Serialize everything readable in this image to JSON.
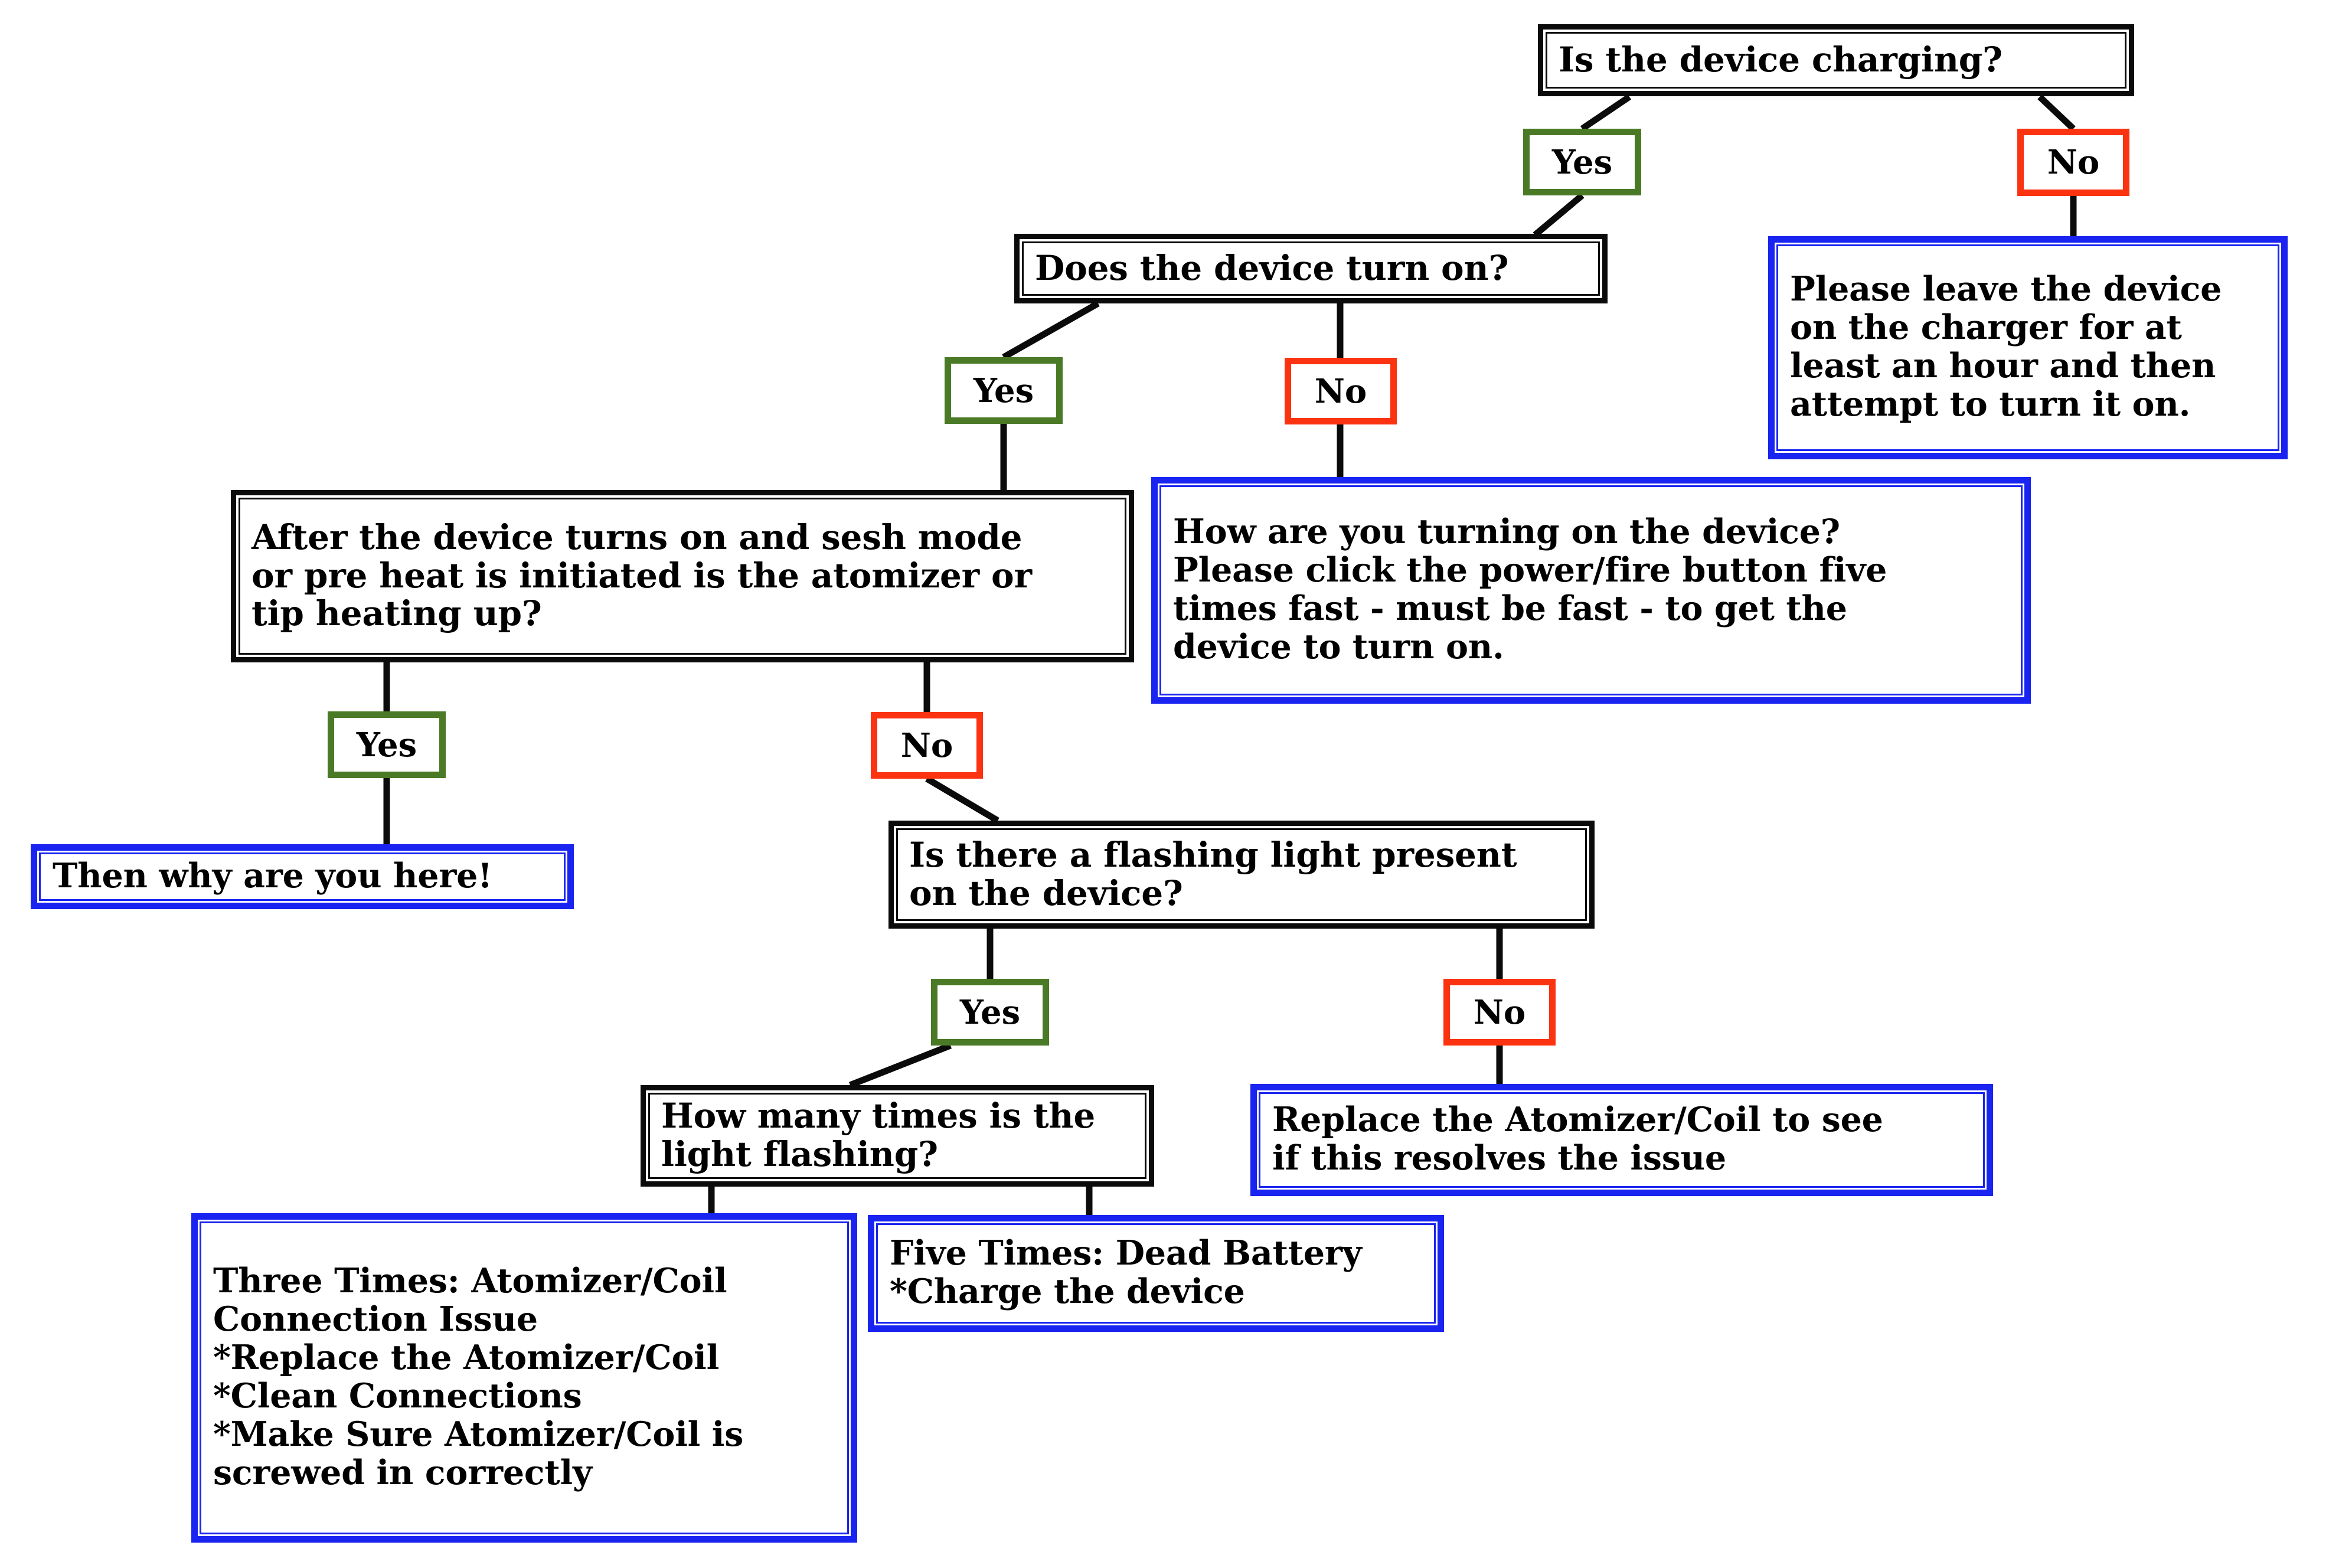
{
  "palette": {
    "black": "#0b0b0b",
    "blue": "#1a24f0",
    "green": "#4a7a26",
    "red": "#fb3311",
    "background": "#ffffff"
  },
  "nodes": {
    "q_charging": {
      "text": "Is the device charging?"
    },
    "q_turn_on": {
      "text": "Does the device turn on?"
    },
    "q_heating": {
      "text": "After the device turns on and sesh mode\nor pre heat is initiated is the atomizer or\ntip heating up?"
    },
    "q_flashing": {
      "text": "Is there a flashing light present\non the device?"
    },
    "q_how_many": {
      "text": "How many times is the\nlight flashing?"
    },
    "r_leave_charger": {
      "text": "Please leave the device\non the charger for at\nleast an hour and then\nattempt to turn it on."
    },
    "r_how_turning": {
      "text": "How are you turning on the device?\nPlease click the power/fire button five\ntimes fast - must be fast - to get the\ndevice to turn on."
    },
    "r_why_here": {
      "text": "Then why are you here!"
    },
    "r_replace_coil": {
      "text": "Replace the Atomizer/Coil to see\nif this resolves the issue"
    },
    "r_three_times": {
      "text": "Three Times: Atomizer/Coil\nConnection Issue\n*Replace the Atomizer/Coil\n*Clean Connections\n*Make Sure Atomizer/Coil is\nscrewed in correctly"
    },
    "r_five_times": {
      "text": "Five Times: Dead Battery\n*Charge the device"
    }
  },
  "chips": {
    "charging_yes": {
      "text": "Yes"
    },
    "charging_no": {
      "text": "No"
    },
    "turnon_yes": {
      "text": "Yes"
    },
    "turnon_no": {
      "text": "No"
    },
    "heating_yes": {
      "text": "Yes"
    },
    "heating_no": {
      "text": "No"
    },
    "flashing_yes": {
      "text": "Yes"
    },
    "flashing_no": {
      "text": "No"
    }
  },
  "chart_data": {
    "type": "diagram",
    "title": "Device Troubleshooting Flowchart",
    "nodes": [
      {
        "id": "q_charging",
        "kind": "question",
        "label": "Is the device charging?"
      },
      {
        "id": "q_turn_on",
        "kind": "question",
        "label": "Does the device turn on?"
      },
      {
        "id": "q_heating",
        "kind": "question",
        "label": "After the device turns on and sesh mode or pre heat is initiated is the atomizer or tip heating up?"
      },
      {
        "id": "q_flashing",
        "kind": "question",
        "label": "Is there a flashing light present on the device?"
      },
      {
        "id": "q_how_many",
        "kind": "question",
        "label": "How many times is the light flashing?"
      },
      {
        "id": "r_leave_charger",
        "kind": "answer",
        "label": "Please leave the device on the charger for at least an hour and then attempt to turn it on."
      },
      {
        "id": "r_how_turning",
        "kind": "answer",
        "label": "How are you turning on the device? Please click the power/fire button five times fast - must be fast - to get the device to turn on."
      },
      {
        "id": "r_why_here",
        "kind": "answer",
        "label": "Then why are you here!"
      },
      {
        "id": "r_replace_coil",
        "kind": "answer",
        "label": "Replace the Atomizer/Coil to see if this resolves the issue"
      },
      {
        "id": "r_three_times",
        "kind": "answer",
        "label": "Three Times: Atomizer/Coil Connection Issue *Replace the Atomizer/Coil *Clean Connections *Make Sure Atomizer/Coil is screwed in correctly"
      },
      {
        "id": "r_five_times",
        "kind": "answer",
        "label": "Five Times: Dead Battery *Charge the device"
      }
    ],
    "edges": [
      {
        "from": "q_charging",
        "to": "q_turn_on",
        "label": "Yes"
      },
      {
        "from": "q_charging",
        "to": "r_leave_charger",
        "label": "No"
      },
      {
        "from": "q_turn_on",
        "to": "q_heating",
        "label": "Yes"
      },
      {
        "from": "q_turn_on",
        "to": "r_how_turning",
        "label": "No"
      },
      {
        "from": "q_heating",
        "to": "r_why_here",
        "label": "Yes"
      },
      {
        "from": "q_heating",
        "to": "q_flashing",
        "label": "No"
      },
      {
        "from": "q_flashing",
        "to": "q_how_many",
        "label": "Yes"
      },
      {
        "from": "q_flashing",
        "to": "r_replace_coil",
        "label": "No"
      },
      {
        "from": "q_how_many",
        "to": "r_three_times",
        "label": "Three Times"
      },
      {
        "from": "q_how_many",
        "to": "r_five_times",
        "label": "Five Times"
      }
    ]
  }
}
